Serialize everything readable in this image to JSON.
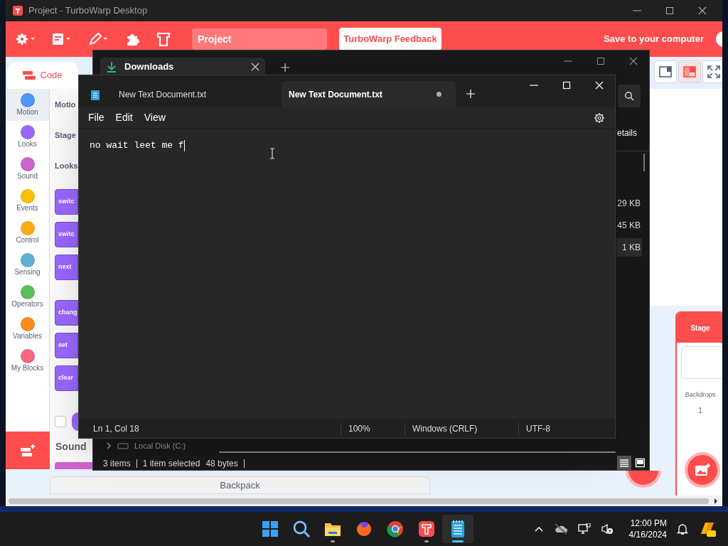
{
  "turbowarp": {
    "title": "Project - TurboWarp Desktop",
    "menu": {
      "project_title": "Project",
      "feedback_button": "TurboWarp Feedback",
      "save_button": "Save to your computer"
    },
    "tabs": [
      {
        "label": "Code",
        "selected": true
      }
    ],
    "stage_size": [
      {
        "kind": "small",
        "selected": false
      },
      {
        "kind": "large",
        "selected": true
      },
      {
        "kind": "fullscreen",
        "selected": false
      }
    ],
    "categories": [
      {
        "label": "Motion",
        "color": "#4c97ff",
        "selected": true
      },
      {
        "label": "Looks",
        "color": "#9966ff",
        "selected": false
      },
      {
        "label": "Sound",
        "color": "#cf63cf",
        "selected": false
      },
      {
        "label": "Events",
        "color": "#ffbf00",
        "selected": false
      },
      {
        "label": "Control",
        "color": "#ffab19",
        "selected": false
      },
      {
        "label": "Sensing",
        "color": "#5cb1d6",
        "selected": false
      },
      {
        "label": "Operators",
        "color": "#59c059",
        "selected": false
      },
      {
        "label": "Variables",
        "color": "#ff8c1a",
        "selected": false
      },
      {
        "label": "My Blocks",
        "color": "#ff6680",
        "selected": false
      }
    ],
    "palette": [
      {
        "kind": "heading",
        "label": "Motio"
      },
      {
        "kind": "heading",
        "label": "Stage"
      },
      {
        "kind": "heading",
        "label": "Looks"
      },
      {
        "kind": "block",
        "label": "switc"
      },
      {
        "kind": "block",
        "label": "switc"
      },
      {
        "kind": "block",
        "label": "next"
      },
      {
        "kind": "gap"
      },
      {
        "kind": "block",
        "label": "chang"
      },
      {
        "kind": "block",
        "label": "set"
      },
      {
        "kind": "block",
        "label": "clear"
      },
      {
        "kind": "reporter",
        "checked": false
      }
    ],
    "sound_heading": "Sound",
    "backpack": "Backpack",
    "stage_panel": {
      "title": "Stage",
      "backdrops_label": "Backdrops",
      "backdrops_count": "1"
    }
  },
  "explorer": {
    "tab": "Downloads",
    "column_header": "etails",
    "sizes": [
      {
        "text": "29 KB",
        "selected": false
      },
      {
        "text": "45 KB",
        "selected": false
      },
      {
        "text": "1 KB",
        "selected": true
      }
    ],
    "drive": "Local Disk (C:)",
    "status": {
      "items": "3 items",
      "selection": "1 item selected",
      "size": "48 bytes"
    },
    "views": [
      {
        "kind": "details",
        "selected": true
      },
      {
        "kind": "tiles",
        "selected": false
      }
    ]
  },
  "notepad": {
    "tabs": [
      {
        "label": "New Text Document.txt",
        "selected": false,
        "modified": false
      },
      {
        "label": "New Text Document.txt",
        "selected": true,
        "modified": true
      }
    ],
    "menu": [
      "File",
      "Edit",
      "View"
    ],
    "text": "no wait leet me f",
    "status": [
      "Ln 1, Col 18",
      "100%",
      "Windows (CRLF)",
      "UTF-8"
    ]
  },
  "taskbar": {
    "apps": [
      {
        "kind": "start",
        "running": false,
        "active": false
      },
      {
        "kind": "search",
        "running": false,
        "active": false
      },
      {
        "kind": "files",
        "running": true,
        "active": false
      },
      {
        "kind": "fox",
        "running": false,
        "active": false
      },
      {
        "kind": "globe",
        "running": false,
        "active": false
      },
      {
        "kind": "turbowarp",
        "running": true,
        "active": false
      },
      {
        "kind": "notepad",
        "running": true,
        "active": true
      }
    ],
    "time": "12:00 PM",
    "date": "4/16/2024"
  }
}
